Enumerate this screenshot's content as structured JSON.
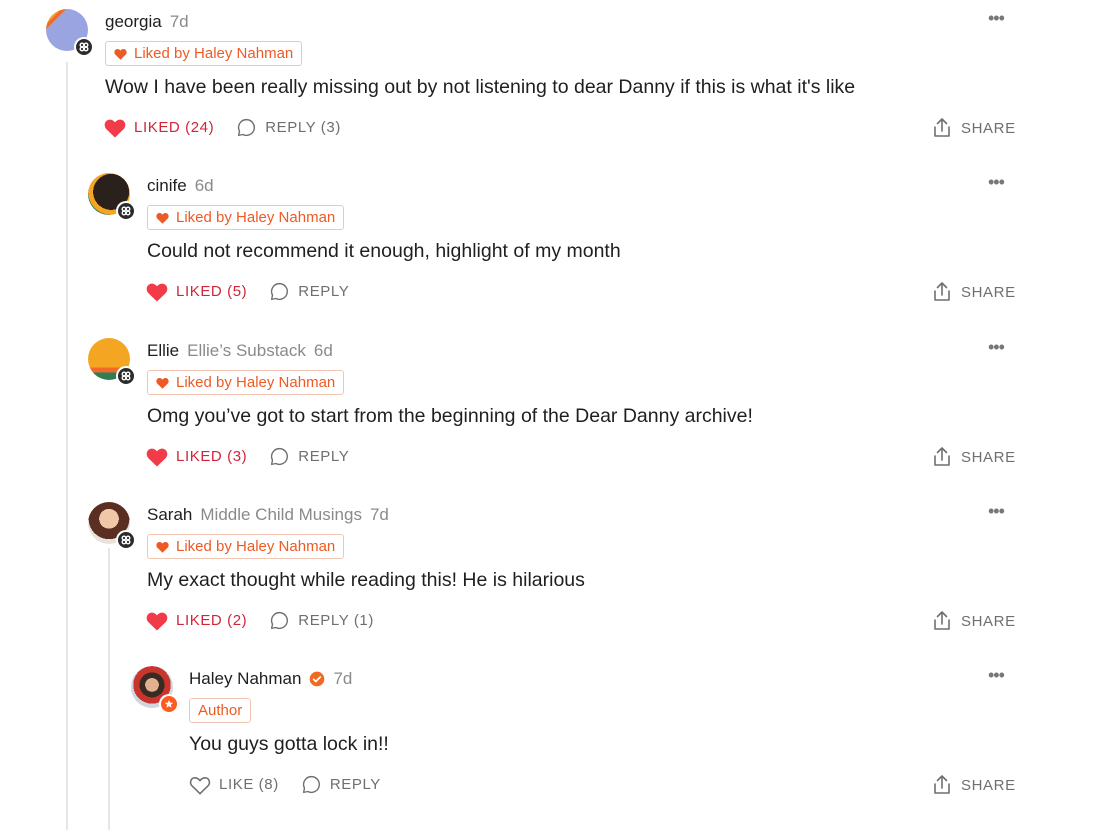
{
  "comments": [
    {
      "name": "georgia",
      "publication": "",
      "time": "7d",
      "chip": "Liked by Haley Nahman",
      "text": "Wow I have been really missing out by not listening to dear Danny if this is what it's like",
      "like": "LIKED (24)",
      "reply": "REPLY (3)",
      "share": "SHARE"
    },
    {
      "name": "cinife",
      "publication": "",
      "time": "6d",
      "chip": "Liked by Haley Nahman",
      "text": "Could not recommend it enough, highlight of my month",
      "like": "LIKED (5)",
      "reply": "REPLY",
      "share": "SHARE"
    },
    {
      "name": "Ellie",
      "publication": "Ellie’s Substack",
      "time": "6d",
      "chip": "Liked by Haley Nahman",
      "text": "Omg you’ve got to start from the beginning of the Dear Danny archive!",
      "like": "LIKED (3)",
      "reply": "REPLY",
      "share": "SHARE"
    },
    {
      "name": "Sarah",
      "publication": "Middle Child Musings",
      "time": "7d",
      "chip": "Liked by Haley Nahman",
      "text": "My exact thought while reading this! He is hilarious",
      "like": "LIKED (2)",
      "reply": "REPLY (1)",
      "share": "SHARE"
    },
    {
      "name": "Haley Nahman",
      "publication": "",
      "time": "7d",
      "chip": "Author",
      "text": "You guys gotta lock in!!",
      "like": "LIKE (8)",
      "reply": "REPLY",
      "share": "SHARE"
    }
  ],
  "colors": {
    "liked": "#d1253a",
    "accent": "#ef5a24",
    "muted": "#8a8a8a"
  },
  "icons": [
    "heart-icon",
    "reply-bubble-icon",
    "share-icon",
    "more-icon",
    "substack-badge-icon",
    "verified-check-icon",
    "author-star-icon"
  ]
}
